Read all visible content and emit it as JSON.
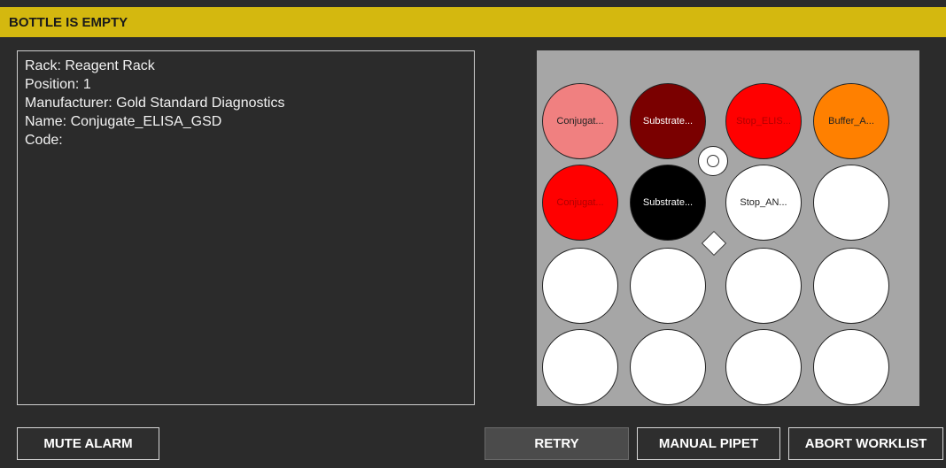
{
  "header": {
    "title": "BOTTLE IS EMPTY",
    "color": "#d4b80f"
  },
  "info": {
    "rack": "Rack: Reagent Rack",
    "position": "Position: 1",
    "manufacturer": "Manufacturer: Gold Standard Diagnostics",
    "name": "Name: Conjugate_ELISA_GSD",
    "code": "Code:"
  },
  "rack": {
    "background": "#a6a6a6",
    "bottles": [
      {
        "label": "Conjugat...",
        "color": "#f08080",
        "text_color": "#222222"
      },
      {
        "label": "Substrate...",
        "color": "#7a0000",
        "text_color": "#ffffff"
      },
      {
        "label": "Stop_ELIS...",
        "color": "#ff0000",
        "text_color": "#b00000"
      },
      {
        "label": "Buffer_A...",
        "color": "#ff8000",
        "text_color": "#222222"
      },
      {
        "label": "Conjugat...",
        "color": "#ff0000",
        "text_color": "#b00000"
      },
      {
        "label": "Substrate...",
        "color": "#000000",
        "text_color": "#ffffff"
      },
      {
        "label": "Stop_AN...",
        "color": "#ffffff",
        "text_color": "#222222"
      },
      {
        "label": "",
        "color": "#ffffff",
        "text_color": "#222222"
      },
      {
        "label": "",
        "color": "#ffffff",
        "text_color": "#222222"
      },
      {
        "label": "",
        "color": "#ffffff",
        "text_color": "#222222"
      },
      {
        "label": "",
        "color": "#ffffff",
        "text_color": "#222222"
      },
      {
        "label": "",
        "color": "#ffffff",
        "text_color": "#222222"
      },
      {
        "label": "",
        "color": "#ffffff",
        "text_color": "#222222"
      },
      {
        "label": "",
        "color": "#ffffff",
        "text_color": "#222222"
      },
      {
        "label": "",
        "color": "#ffffff",
        "text_color": "#222222"
      },
      {
        "label": "",
        "color": "#ffffff",
        "text_color": "#222222"
      }
    ]
  },
  "buttons": {
    "mute": "MUTE ALARM",
    "retry": "RETRY",
    "manual": "MANUAL PIPET",
    "abort": "ABORT WORKLIST"
  }
}
